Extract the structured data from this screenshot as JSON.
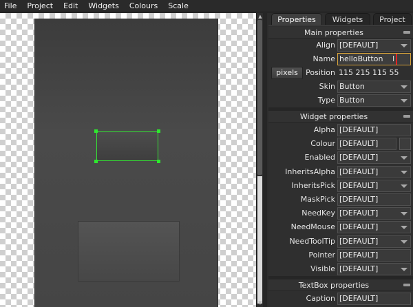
{
  "menu": [
    "File",
    "Project",
    "Edit",
    "Widgets",
    "Colours",
    "Scale"
  ],
  "tabs": [
    {
      "label": "Properties",
      "active": true
    },
    {
      "label": "Widgets",
      "active": false
    },
    {
      "label": "Project",
      "active": false
    }
  ],
  "main": {
    "title": "Main properties",
    "align": {
      "label": "Align",
      "value": "[DEFAULT]"
    },
    "name": {
      "label": "Name",
      "value": "helloButton"
    },
    "position": {
      "button": "pixels",
      "label": "Position",
      "value": "115 215 115 55"
    },
    "skin": {
      "label": "Skin",
      "value": "Button"
    },
    "type": {
      "label": "Type",
      "value": "Button"
    }
  },
  "widget": {
    "title": "Widget properties",
    "rows": [
      {
        "label": "Alpha",
        "value": "[DEFAULT]",
        "kind": "text"
      },
      {
        "label": "Colour",
        "value": "[DEFAULT]",
        "kind": "colour"
      },
      {
        "label": "Enabled",
        "value": "[DEFAULT]",
        "kind": "dropdown"
      },
      {
        "label": "InheritsAlpha",
        "value": "[DEFAULT]",
        "kind": "dropdown"
      },
      {
        "label": "InheritsPick",
        "value": "[DEFAULT]",
        "kind": "dropdown"
      },
      {
        "label": "MaskPick",
        "value": "[DEFAULT]",
        "kind": "text"
      },
      {
        "label": "NeedKey",
        "value": "[DEFAULT]",
        "kind": "dropdown"
      },
      {
        "label": "NeedMouse",
        "value": "[DEFAULT]",
        "kind": "dropdown"
      },
      {
        "label": "NeedToolTip",
        "value": "[DEFAULT]",
        "kind": "dropdown"
      },
      {
        "label": "Pointer",
        "value": "[DEFAULT]",
        "kind": "text"
      },
      {
        "label": "Visible",
        "value": "[DEFAULT]",
        "kind": "dropdown"
      }
    ]
  },
  "textbox": {
    "title": "TextBox properties",
    "caption": {
      "label": "Caption",
      "value": "[DEFAULT]"
    }
  },
  "colors": {
    "selection": "#35e235",
    "focus": "#d6a23a",
    "highlight": "#e02424"
  }
}
